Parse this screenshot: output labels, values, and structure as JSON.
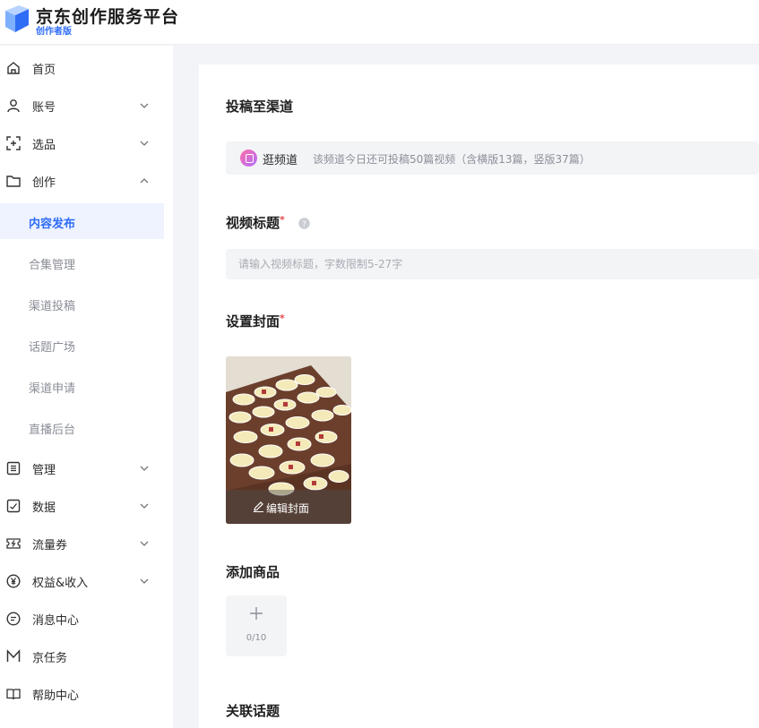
{
  "header": {
    "title": "京东创作服务平台",
    "subtitle": "创作者版"
  },
  "sidebar": {
    "items": [
      {
        "label": "首页",
        "icon": "home-icon"
      },
      {
        "label": "账号",
        "icon": "user-icon"
      },
      {
        "label": "选品",
        "icon": "select-icon"
      },
      {
        "label": "创作",
        "icon": "folder-icon"
      },
      {
        "label": "管理",
        "icon": "list-icon"
      },
      {
        "label": "数据",
        "icon": "chart-icon"
      },
      {
        "label": "流量券",
        "icon": "coupon-icon"
      },
      {
        "label": "权益&收入",
        "icon": "yen-icon"
      },
      {
        "label": "消息中心",
        "icon": "message-icon"
      },
      {
        "label": "京任务",
        "icon": "m-icon"
      },
      {
        "label": "帮助中心",
        "icon": "book-icon"
      }
    ],
    "sub_items": [
      "内容发布",
      "合集管理",
      "渠道投稿",
      "话题广场",
      "渠道申请",
      "直播后台"
    ]
  },
  "main": {
    "channel_title": "投稿至渠道",
    "channel_name": "逛频道",
    "channel_desc": "该频道今日还可投稿50篇视频（含横版13篇，竖版37篇）",
    "video_title_label": "视频标题",
    "video_title_placeholder": "请输入视频标题，字数限制5-27字",
    "required_mark": "*",
    "cover_label": "设置封面",
    "edit_cover_label": "编辑封面",
    "add_goods_label": "添加商品",
    "goods_count": "0/10",
    "topic_label": "关联话题"
  },
  "colors": {
    "accent": "#2f6cf6",
    "required": "#e5484d"
  }
}
